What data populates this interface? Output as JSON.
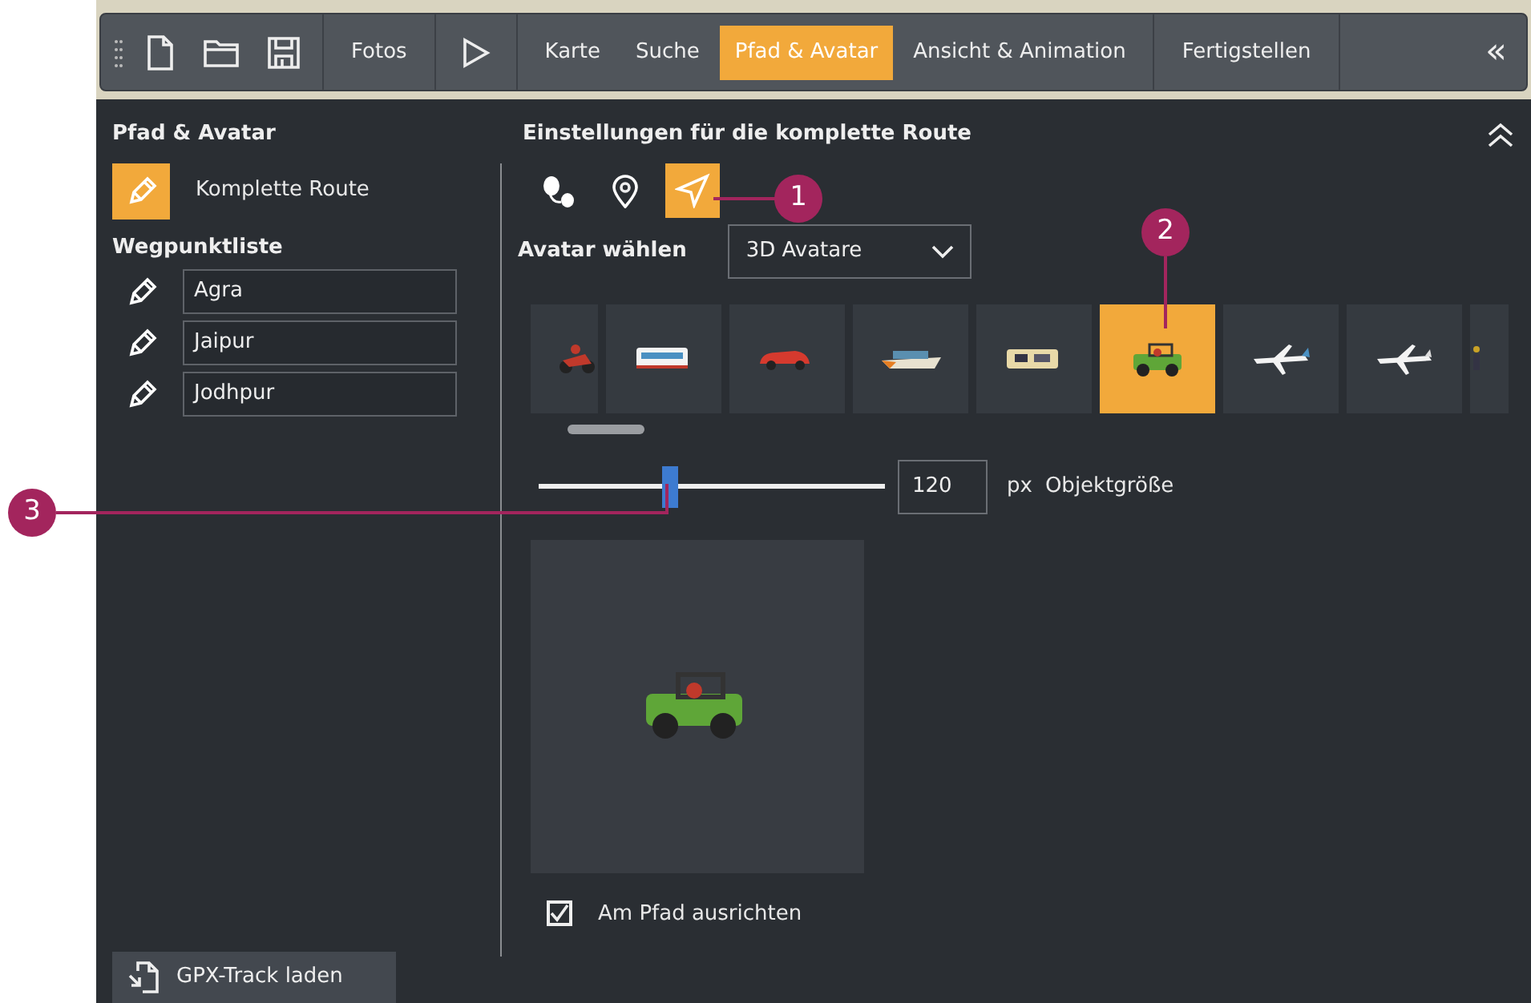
{
  "toolbar": {
    "groups": [
      {
        "kind": "files"
      },
      {
        "kind": "tabs",
        "tabs": [
          {
            "label": "Fotos",
            "selected": false
          }
        ]
      },
      {
        "kind": "play"
      },
      {
        "kind": "tabs",
        "tabs": [
          {
            "label": "Karte",
            "selected": false
          },
          {
            "label": "Suche",
            "selected": false
          },
          {
            "label": "Pfad & Avatar",
            "selected": true
          },
          {
            "label": "Ansicht & Animation",
            "selected": false
          }
        ]
      },
      {
        "kind": "tabs",
        "tabs": [
          {
            "label": "Fertigstellen",
            "selected": false
          }
        ]
      }
    ],
    "collapse": "«"
  },
  "left_panel": {
    "title": "Pfad & Avatar",
    "route": {
      "label": "Komplette Route",
      "selected": true
    },
    "waypoints_title": "Wegpunktliste",
    "waypoints": [
      {
        "name": "Agra"
      },
      {
        "name": "Jaipur"
      },
      {
        "name": "Jodhpur"
      }
    ],
    "load_button": "GPX-Track laden"
  },
  "right_panel": {
    "title": "Einstellungen für die komplette Route",
    "modes": [
      {
        "kind": "path",
        "selected": false
      },
      {
        "kind": "pin",
        "selected": false
      },
      {
        "kind": "avatar",
        "selected": true
      }
    ],
    "avatar_label": "Avatar wählen",
    "avatar_type": "3D Avatare",
    "avatars": [
      {
        "kind": "motorbike",
        "selected": false
      },
      {
        "kind": "bus",
        "selected": false
      },
      {
        "kind": "car",
        "selected": false
      },
      {
        "kind": "ship",
        "selected": false
      },
      {
        "kind": "raft",
        "selected": false
      },
      {
        "kind": "jeep",
        "selected": true
      },
      {
        "kind": "jet",
        "selected": false
      },
      {
        "kind": "plane",
        "selected": false
      },
      {
        "kind": "figure",
        "selected": false
      }
    ],
    "size": {
      "level": 0.38,
      "value": "120",
      "unit": "px",
      "label": "Objektgröße"
    },
    "align": {
      "label": "Am Pfad ausrichten",
      "checked": true
    }
  },
  "callouts": [
    {
      "number": "1"
    },
    {
      "number": "2"
    },
    {
      "number": "3"
    }
  ]
}
